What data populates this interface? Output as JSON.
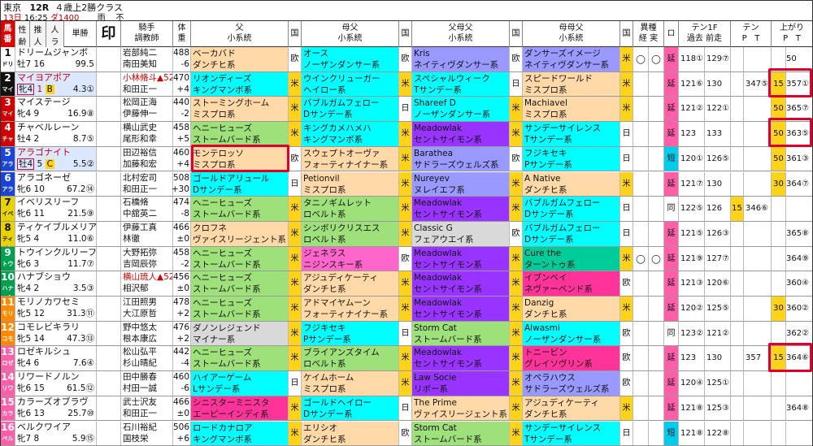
{
  "header": {
    "venue": "東京",
    "race": "12R",
    "race_name": "４歳上2勝クラス",
    "day": "13日",
    "time": "16:25",
    "course": "ダ1400",
    "weather": "雨",
    "going": "不"
  },
  "columns": {
    "num": "馬番",
    "age": "性齢",
    "rank": "推人",
    "waku": "人ラ",
    "odds": "単勝",
    "mark": "印",
    "jockey": "騎手調教師",
    "weight": "体重",
    "sire": "父小系統",
    "c1": "国",
    "dam_sire": "母父小系統",
    "c2": "国",
    "ss": "父母父小系統",
    "c3": "国",
    "ds": "母母父小系統",
    "c4": "国",
    "variant": "異種経実",
    "ro": "ロ",
    "ten1": "テン1F過去前走",
    "ten": "テンPT",
    "agari": "上がりPT"
  },
  "colors": {
    "sunday": "#00ffff",
    "north": "#ffd9a8",
    "minstrel": "#ccff33",
    "mrp": "#9933ff",
    "nas": "#9999ff",
    "stormcat": "#00cc99",
    "roberto": "#8de05c",
    "hail": "#cc66ff",
    "gone": "#ff3399",
    "nijinsky": "#ff9933"
  },
  "rows": [
    {
      "num": "1",
      "short": "ドリー",
      "name": "ドリームジャンボ",
      "age": "牡7",
      "pop": "16",
      "odds": "99.5",
      "jockey": "岩部純二",
      "trainer": "南田美知",
      "wt": "55",
      "bw": "488",
      "diff": "-6",
      "sire1": "ベーカバド",
      "sire2": "ダンチヒ系",
      "sire_c": "欧",
      "dam1": "オース",
      "dam2": "ノーザンダンサー系",
      "dam_c": "欧",
      "ss1": "Kris",
      "ss2": "ネイティヴダンサー系",
      "ss_c": "欧",
      "ds1": "ダンサーズイメージ",
      "ds2": "ネイティヴダンサー系",
      "ds_c": "米",
      "v1": "◯",
      "v2": "◯",
      "ro": "延",
      "past": "118①",
      "last": "129⑦",
      "tp": "",
      "tt": "",
      "ap": "",
      "at": "50"
    },
    {
      "num": "2",
      "short": "マイヨ",
      "name": "マイヨアポア",
      "age": "牝4",
      "pop": "1",
      "odds": "4.3①",
      "jockey": "小林脩斗▲52",
      "trainer": "和田正一",
      "wt": "",
      "bw": "470",
      "diff": "+4",
      "sire1": "リオンディーズ",
      "sire2": "キングマンボ系",
      "sire_c": "米",
      "dam1": "ウインクリューガー",
      "dam2": "ヘイロー系",
      "dam_c": "米",
      "ss1": "スペシャルウィーク",
      "ss2": "Tサンデー系",
      "ss_c": "日",
      "ds1": "スピードワールド",
      "ds2": "ミスプロ系",
      "ds_c": "米",
      "v1": "",
      "v2": "",
      "ro": "延",
      "past": "121⑥",
      "last": "130",
      "tp": "",
      "tt": "347⑤",
      "ap": "15",
      "at": "357①"
    },
    {
      "num": "3",
      "short": "マイス",
      "name": "マイステージ",
      "age": "牝4",
      "pop": "9",
      "odds": "16.9⑧",
      "jockey": "松岡正海",
      "trainer": "伊藤伸一",
      "wt": "55",
      "bw": "440",
      "diff": "-2",
      "sire1": "ストーミングホーム",
      "sire2": "ミスプロ系",
      "sire_c": "米",
      "dam1": "バブルガムフェロー",
      "dam2": "Dサンデー系",
      "dam_c": "日",
      "ss1": "Shareef D",
      "ss2": "ノーザンダンサー系",
      "ss_c": "米",
      "ds1": "Machiavel",
      "ds2": "ミスプロ系",
      "ds_c": "米",
      "v1": "",
      "v2": "",
      "ro": "延",
      "past": "121②",
      "last": "122①",
      "tp": "",
      "tt": "",
      "ap": "50",
      "at": "365⑦"
    },
    {
      "num": "4",
      "short": "チャベ",
      "name": "チャベルレーン",
      "age": "牡4",
      "pop": "2",
      "odds": "8.7⑤",
      "jockey": "横山武史",
      "trainer": "尾形和幸",
      "wt": "55",
      "bw": "458",
      "diff": "+5",
      "sire1": "ヘニーヒューズ",
      "sire2": "ストームバード系",
      "sire_c": "米",
      "dam1": "キングカメハメハ",
      "dam2": "キングマンボ系",
      "dam_c": "米",
      "ss1": "Meadowlak",
      "ss2": "セントサイモン系",
      "ss_c": "米",
      "ds1": "サンデーサイレンス",
      "ds2": "Tサンデー系",
      "ds_c": "日",
      "v1": "",
      "v2": "",
      "ro": "延",
      "past": "123",
      "last": "133",
      "tp": "",
      "tt": "",
      "ap": "50",
      "at": "363⑤"
    },
    {
      "num": "5",
      "short": "アラゴ",
      "name": "アラゴナイト",
      "age": "牡4",
      "pop": "5",
      "odds": "5.5②",
      "jockey": "田辺裕信",
      "trainer": "加藤和宏",
      "wt": "55",
      "bw": "460",
      "diff": "+4",
      "sire1": "モンテロッソ",
      "sire2": "ミスプロ系",
      "sire_c": "欧",
      "dam1": "スウェプトオーヴァ",
      "dam2": "フォーティナイナー系",
      "dam_c": "米",
      "ss1": "Barathea",
      "ss2": "サドラーズウェルズ系",
      "ss_c": "欧",
      "ds1": "フジキセキ",
      "ds2": "Pサンデー系",
      "ds_c": "日",
      "v1": "",
      "v2": "",
      "ro": "短",
      "past": "120①",
      "last": "126⑤",
      "tp": "",
      "tt": "",
      "ap": "50",
      "at": "361③"
    },
    {
      "num": "6",
      "short": "アラゴ",
      "name": "アラゴネーゼ",
      "age": "牝6",
      "pop": "10",
      "odds": "67.2⑭",
      "jockey": "北村宏司",
      "trainer": "和田正一",
      "wt": "55",
      "bw": "508",
      "diff": "+30",
      "sire1": "ゴールドアリュール",
      "sire2": "Dサンデー系",
      "sire_c": "日",
      "dam1": "Petionvil",
      "dam2": "ミスプロ系",
      "dam_c": "米",
      "ss1": "Nureyev",
      "ss2": "ヌレイエフ系",
      "ss_c": "米",
      "ds1": "A Native",
      "ds2": "ダンチヒ系",
      "ds_c": "米",
      "v1": "",
      "v2": "",
      "ro": "延",
      "past": "121⑦",
      "last": "130",
      "tp": "",
      "tt": "",
      "ap": "30",
      "at": "364⑦"
    },
    {
      "num": "7",
      "short": "イベリ",
      "name": "イベリスリーフ",
      "age": "牝6",
      "pop": "11",
      "odds": "21.5⑨",
      "jockey": "石橋脩",
      "trainer": "中舘英二",
      "wt": "55",
      "bw": "474",
      "diff": "-8",
      "sire1": "ヘニーヒューズ",
      "sire2": "ストームバード系",
      "sire_c": "米",
      "dam1": "タニノギムレット",
      "dam2": "ロベルト系",
      "dam_c": "米",
      "ss1": "Meadowlak",
      "ss2": "セントサイモン系",
      "ss_c": "米",
      "ds1": "バブルガムフェロー",
      "ds2": "Dサンデー系",
      "ds_c": "日",
      "v1": "",
      "v2": "",
      "ro": "同",
      "past": "122⑤",
      "last": "126",
      "tp": "15",
      "tt": "346⑥",
      "ap": "",
      "at": ""
    },
    {
      "num": "8",
      "short": "ティケ",
      "name": "ティケイブルメリア",
      "age": "牝5",
      "pop": "4",
      "odds": "11.0⑥",
      "jockey": "伊藤工真",
      "trainer": "林徹",
      "wt": "55",
      "bw": "466",
      "diff": "±0",
      "sire1": "クロフネ",
      "sire2": "ヴァイスリージェント系",
      "sire_c": "米",
      "dam1": "シンボリクリスエス",
      "dam2": "ロベルト系",
      "dam_c": "米",
      "ss1": "Classic G",
      "ss2": "フェアウエイ系",
      "ss_c": "欧",
      "ds1": "バブルガムフェロー",
      "ds2": "Dサンデー系",
      "ds_c": "日",
      "v1": "",
      "v2": "",
      "ro": "延",
      "past": "121⑤",
      "last": "126③",
      "tp": "",
      "tt": "",
      "ap": "",
      "at": "365⑧"
    },
    {
      "num": "9",
      "short": "トウイ",
      "name": "トウインクルリーフ",
      "age": "牝6",
      "pop": "3",
      "odds": "11.7⑦",
      "jockey": "大野拓弥",
      "trainer": "吉岡辰弥",
      "wt": "55",
      "bw": "458",
      "diff": "-2",
      "sire1": "ヘニーヒューズ",
      "sire2": "ストームバード系",
      "sire_c": "米",
      "dam1": "ジェネラス",
      "dam2": "ニジンスキー系",
      "dam_c": "欧",
      "ss1": "Meadowlak",
      "ss2": "セントサイモン系",
      "ss_c": "米",
      "ds1": "Cure the",
      "ds2": "ターントゥ系",
      "ds_c": "米",
      "v1": "◯",
      "v2": "◯",
      "ro": "延",
      "past": "121⑨",
      "last": "127⑦",
      "tp": "",
      "tt": "",
      "ap": "",
      "at": "364⑨"
    },
    {
      "num": "10",
      "short": "ハナブ",
      "name": "ハナブショウ",
      "age": "牝4",
      "pop": "2",
      "odds": "3.5③",
      "jockey": "横山琉人▲52",
      "trainer": "相沢郁",
      "wt": "",
      "bw": "456",
      "diff": "±0",
      "sire1": "ヘニーヒューズ",
      "sire2": "ストームバード系",
      "sire_c": "米",
      "dam1": "アジュディケーティ",
      "dam2": "ダンチヒ系",
      "dam_c": "米",
      "ss1": "Meadowlak",
      "ss2": "セントサイモン系",
      "ss_c": "米",
      "ds1": "イブンベイ",
      "ds2": "ネヴァーベンド系",
      "ds_c": "欧",
      "v1": "",
      "v2": "",
      "ro": "延",
      "past": "121③",
      "last": "120⑥",
      "tp": "",
      "tt": "",
      "ap": "",
      "at": "360④"
    },
    {
      "num": "11",
      "short": "モリノ",
      "name": "モリノカワセミ",
      "age": "牝5",
      "pop": "12",
      "odds": "31.3⑪",
      "jockey": "江田照男",
      "trainer": "大江原哲",
      "wt": "55",
      "bw": "478",
      "diff": "+2",
      "sire1": "ヘニーヒューズ",
      "sire2": "ストームバード系",
      "sire_c": "米",
      "dam1": "アドマイヤムーン",
      "dam2": "フォーティナイナー系",
      "dam_c": "米",
      "ss1": "Meadowlak",
      "ss2": "セントサイモン系",
      "ss_c": "米",
      "ds1": "Danzig",
      "ds2": "ダンチヒ系",
      "ds_c": "米",
      "v1": "",
      "v2": "",
      "ro": "延",
      "past": "120②",
      "last": "125⑤",
      "tp": "",
      "tt": "",
      "ap": "30",
      "at": "360②"
    },
    {
      "num": "12",
      "short": "コモレ",
      "name": "コモレビキラリ",
      "age": "牝5",
      "pop": "14",
      "odds": "47.3⑬",
      "jockey": "野中悠太",
      "trainer": "根本康広",
      "wt": "55",
      "bw": "476",
      "diff": "+2",
      "sire1": "ダノンレジェンド",
      "sire2": "マイナー系",
      "sire_c": "米",
      "dam1": "フジキセキ",
      "dam2": "Pサンデー系",
      "dam_c": "日",
      "ss1": "Storm Cat",
      "ss2": "ストームバード系",
      "ss_c": "米",
      "ds1": "Alwasmi",
      "ds2": "ノーザンダンサー系",
      "ds_c": "欧",
      "v1": "",
      "v2": "",
      "ro": "同",
      "past": "123②",
      "last": "121②",
      "tp": "",
      "tt": "",
      "ap": "",
      "at": "362②"
    },
    {
      "num": "13",
      "short": "ロゼキ",
      "name": "ロゼキルシュ",
      "age": "牝4",
      "pop": "6",
      "odds": "7.6④",
      "jockey": "松山弘平",
      "trainer": "杉山晴紀",
      "wt": "55",
      "bw": "442",
      "diff": "-4",
      "sire1": "ヘニーヒューズ",
      "sire2": "ストームバード系",
      "sire_c": "米",
      "dam1": "ブライアンズタイム",
      "dam2": "ロベルト系",
      "dam_c": "米",
      "ss1": "Meadowlak",
      "ss2": "セントサイモン系",
      "ss_c": "米",
      "ds1": "トニービン",
      "ds2": "グレイソヴリン系",
      "ds_c": "欧",
      "v1": "",
      "v2": "",
      "ro": "延",
      "past": "123",
      "last": "130",
      "tp": "",
      "tt": "357",
      "ap": "15",
      "at": "364⑥"
    },
    {
      "num": "14",
      "short": "リワー",
      "name": "リワードノルン",
      "age": "牝6",
      "pop": "15",
      "odds": "61.5⑫",
      "jockey": "田中勝春",
      "trainer": "村田一誠",
      "wt": "55",
      "bw": "460",
      "diff": "-6",
      "sire1": "ハイアーゲーム",
      "sire2": "Lサンデー系",
      "sire_c": "日",
      "dam1": "ケイムホーム",
      "dam2": "ミスプロ系",
      "dam_c": "米",
      "ss1": "Law Socie",
      "ss2": "リボー系",
      "ss_c": "米",
      "ds1": "オペラハウス",
      "ds2": "サドラーズウェルズ系",
      "ds_c": "欧",
      "v1": "",
      "v2": "",
      "ro": "延",
      "past": "120④",
      "last": "125①",
      "tp": "",
      "tt": "",
      "ap": "",
      "at": ""
    },
    {
      "num": "15",
      "short": "カラー",
      "name": "カラーズオブラヴ",
      "age": "牝6",
      "pop": "13",
      "odds": "25.7⑩",
      "jockey": "武士沢友",
      "trainer": "和田正一",
      "wt": "55",
      "bw": "466",
      "diff": "±0",
      "sire1": "シニスターミニスタ",
      "sire2": "エーピーインディ系",
      "sire_c": "米",
      "dam1": "ゴールドヘイロー",
      "dam2": "Dサンデー系",
      "dam_c": "日",
      "ss1": "The Prime",
      "ss2": "ヴァイスリージェント系",
      "ss_c": "米",
      "ds1": "アジュディケーティ",
      "ds2": "ダンチヒ系",
      "ds_c": "米",
      "v1": "",
      "v2": "",
      "ro": "延",
      "past": "121⑧",
      "last": "125③",
      "tp": "",
      "tt": "",
      "ap": "",
      "at": "364⑧"
    },
    {
      "num": "16",
      "short": "ベルク",
      "name": "ベルクワイア",
      "age": "牝7",
      "pop": "8",
      "odds": "5.9⑮",
      "jockey": "石川裕紀",
      "trainer": "国枝栄",
      "wt": "55",
      "bw": "506",
      "diff": "+6",
      "sire1": "ロードカナロア",
      "sire2": "キングマンボ系",
      "sire_c": "米",
      "dam1": "エリシオ",
      "dam2": "ダンチヒ系",
      "dam_c": "欧",
      "ss1": "Storm Cat",
      "ss2": "ストームバード系",
      "ss_c": "米",
      "ds1": "サンデーサイレンス",
      "ds2": "Tサンデー系",
      "ds_c": "日",
      "v1": "",
      "v2": "",
      "ro": "短",
      "past": "121⑧",
      "last": "122⑧",
      "tp": "",
      "tt": "",
      "ap": "",
      "at": ""
    }
  ]
}
